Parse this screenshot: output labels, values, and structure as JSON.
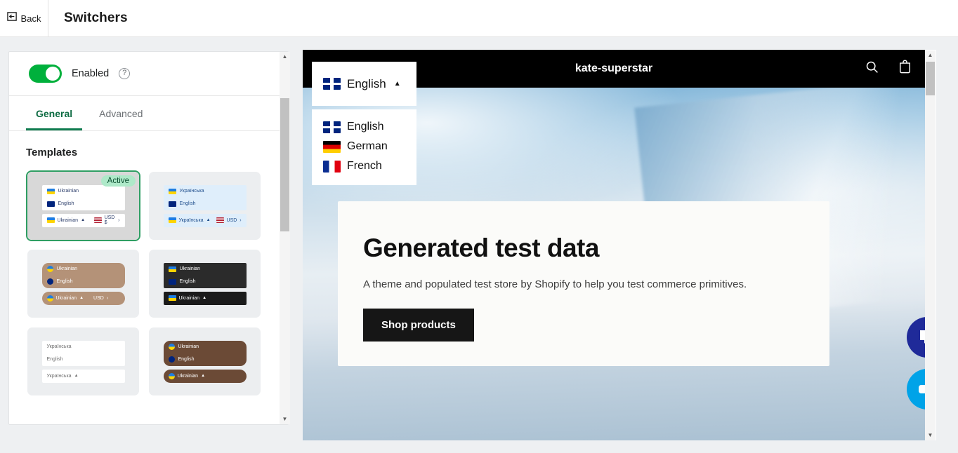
{
  "topbar": {
    "back_label": "Back",
    "back_icon": "back-arrow-icon",
    "title": "Switchers"
  },
  "settings_panel": {
    "enabled_label": "Enabled",
    "enabled_state": "on",
    "help_icon": "question-mark-icon",
    "toggle_color": "#00b03c",
    "tabs": [
      {
        "label": "General",
        "active": true
      },
      {
        "label": "Advanced",
        "active": false
      }
    ],
    "section_title": "Templates",
    "active_badge": "Active",
    "templates": [
      {
        "id": "tpl-1",
        "selected": true,
        "active": true,
        "bg": "#d8d8d8",
        "list_bg": "#ffffff",
        "bar_bg": "#ffffff",
        "text_color": "#2c3e6b",
        "rounded": false,
        "show_flags": true,
        "rows": [
          {
            "flag": "fl-ua",
            "label": "Ukrainian"
          },
          {
            "flag": "fl-uk",
            "label": "English"
          }
        ],
        "bar": {
          "flag": "fl-ua",
          "label": "Ukrainian",
          "caret": "▲",
          "currency_flag": "fl-us",
          "currency": "USD $",
          "currency_caret": "›"
        }
      },
      {
        "id": "tpl-2",
        "selected": false,
        "active": false,
        "bg": "#eceef0",
        "list_bg": "#dfeefb",
        "bar_bg": "#dfeefb",
        "text_color": "#1f4e8c",
        "rounded": false,
        "show_flags": true,
        "rows": [
          {
            "flag": "fl-ua",
            "label": "Українська"
          },
          {
            "flag": "fl-uk",
            "label": "English"
          }
        ],
        "bar": {
          "flag": "fl-ua",
          "label": "Українська",
          "caret": "▲",
          "currency_flag": "fl-us",
          "currency": "USD",
          "currency_caret": "›"
        }
      },
      {
        "id": "tpl-3",
        "selected": false,
        "active": false,
        "bg": "#eceef0",
        "list_bg": "#b49278",
        "bar_bg": "#b49278",
        "text_color": "#ffffff",
        "rounded": true,
        "show_flags": true,
        "rows": [
          {
            "flag": "fl-ua",
            "label": "Ukrainian"
          },
          {
            "flag": "fl-uk",
            "label": "English"
          }
        ],
        "bar": {
          "flag": "fl-ua",
          "label": "Ukrainian",
          "caret": "▲",
          "currency_flag": "",
          "currency": "USD",
          "currency_caret": "›"
        }
      },
      {
        "id": "tpl-4",
        "selected": false,
        "active": false,
        "bg": "#eceef0",
        "list_bg": "#2b2b2b",
        "bar_bg": "#1b1b1b",
        "text_color": "#ffffff",
        "rounded": false,
        "show_flags": true,
        "rows": [
          {
            "flag": "fl-ua",
            "label": "Ukrainian"
          },
          {
            "flag": "fl-uk",
            "label": "English"
          }
        ],
        "bar": {
          "flag": "fl-ua",
          "label": "Ukrainian",
          "caret": "▲",
          "currency_flag": "",
          "currency": "",
          "currency_caret": ""
        }
      },
      {
        "id": "tpl-5",
        "selected": false,
        "active": false,
        "bg": "#eceef0",
        "list_bg": "#ffffff",
        "bar_bg": "#ffffff",
        "text_color": "#707070",
        "rounded": false,
        "show_flags": false,
        "rows": [
          {
            "flag": "",
            "label": "Українська"
          },
          {
            "flag": "",
            "label": "English"
          }
        ],
        "bar": {
          "flag": "",
          "label": "Українська",
          "caret": "▲",
          "currency_flag": "",
          "currency": "",
          "currency_caret": ""
        }
      },
      {
        "id": "tpl-6",
        "selected": false,
        "active": false,
        "bg": "#eceef0",
        "list_bg": "#6b4a36",
        "bar_bg": "#6b4a36",
        "text_color": "#ffffff",
        "rounded": true,
        "show_flags": true,
        "rows": [
          {
            "flag": "fl-ua",
            "label": "Ukrainian"
          },
          {
            "flag": "fl-uk",
            "label": "English"
          }
        ],
        "bar": {
          "flag": "fl-ua",
          "label": "Ukrainian",
          "caret": "▲",
          "currency_flag": "",
          "currency": "",
          "currency_caret": ""
        }
      }
    ]
  },
  "preview": {
    "store_name": "kate-superstar",
    "search_icon": "search-icon",
    "cart_icon": "shopping-bag-icon",
    "hero": {
      "title": "Generated test data",
      "subtitle": "A theme and populated test store by Shopify to help you test commerce primitives.",
      "button_label": "Shop products"
    },
    "switcher": {
      "selected_flag": "f2-uk",
      "selected_label": "English",
      "caret": "▲",
      "options": [
        {
          "flag": "f2-uk",
          "label": "English"
        },
        {
          "flag": "f2-de",
          "label": "German"
        },
        {
          "flag": "f2-fr",
          "label": "French"
        }
      ]
    },
    "fabs": [
      {
        "name": "chat-bubble-icon",
        "color": "#1f2a99"
      },
      {
        "name": "video-camera-icon",
        "color": "#00a3e8"
      }
    ]
  },
  "scrollbars": {
    "up_arrow": "▲",
    "down_arrow": "▼"
  }
}
